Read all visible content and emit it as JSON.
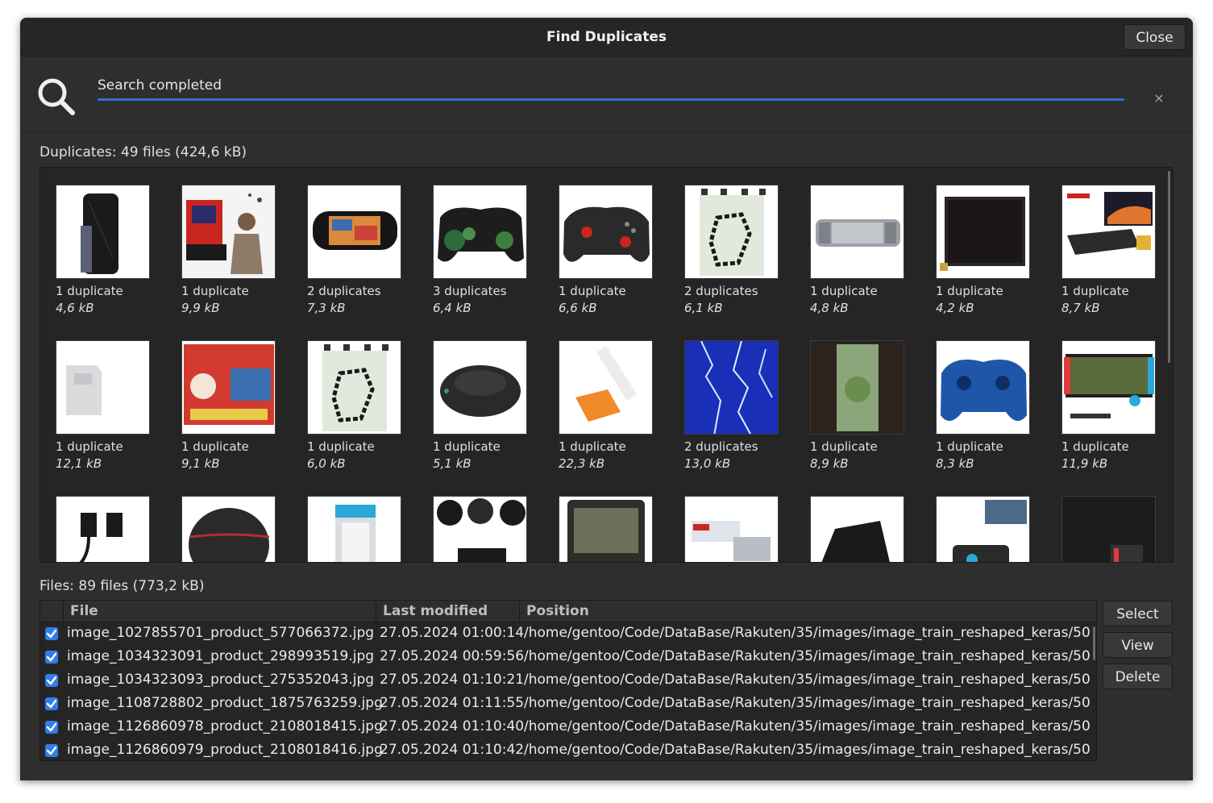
{
  "window": {
    "title": "Find Duplicates",
    "close_label": "Close"
  },
  "search": {
    "status": "Search completed",
    "progress": 1.0,
    "dismiss_glyph": "×"
  },
  "duplicates": {
    "summary": "Duplicates: 49 files (424,6 kB)",
    "items": [
      {
        "count": "1 duplicate",
        "size": "4,6 kB"
      },
      {
        "count": "1 duplicate",
        "size": "9,9 kB"
      },
      {
        "count": "2 duplicates",
        "size": "7,3 kB"
      },
      {
        "count": "3 duplicates",
        "size": "6,4 kB"
      },
      {
        "count": "1 duplicate",
        "size": "6,6 kB"
      },
      {
        "count": "2 duplicates",
        "size": "6,1 kB"
      },
      {
        "count": "1 duplicate",
        "size": "4,8 kB"
      },
      {
        "count": "1 duplicate",
        "size": "4,2 kB"
      },
      {
        "count": "1 duplicate",
        "size": "8,7 kB"
      },
      {
        "count": "1 duplicate",
        "size": "12,1 kB"
      },
      {
        "count": "1 duplicate",
        "size": "9,1 kB"
      },
      {
        "count": "1 duplicate",
        "size": "6,0 kB"
      },
      {
        "count": "1 duplicate",
        "size": "5,1 kB"
      },
      {
        "count": "1 duplicate",
        "size": "22,3 kB"
      },
      {
        "count": "2 duplicates",
        "size": "13,0 kB"
      },
      {
        "count": "1 duplicate",
        "size": "8,9 kB"
      },
      {
        "count": "1 duplicate",
        "size": "8,3 kB"
      },
      {
        "count": "1 duplicate",
        "size": "11,9 kB"
      }
    ]
  },
  "files": {
    "summary": "Files: 89 files (773,2 kB)",
    "columns": [
      "File",
      "Last modified",
      "Position"
    ],
    "rows": [
      {
        "file": "image_1027855701_product_577066372.jpg",
        "modified": "27.05.2024 01:00:14",
        "position": "/home/gentoo/Code/DataBase/Rakuten/35/images/image_train_reshaped_keras/50"
      },
      {
        "file": "image_1034323091_product_298993519.jpg",
        "modified": "27.05.2024 00:59:56",
        "position": "/home/gentoo/Code/DataBase/Rakuten/35/images/image_train_reshaped_keras/50"
      },
      {
        "file": "image_1034323093_product_275352043.jpg",
        "modified": "27.05.2024 01:10:21",
        "position": "/home/gentoo/Code/DataBase/Rakuten/35/images/image_train_reshaped_keras/50"
      },
      {
        "file": "image_1108728802_product_1875763259.jpg",
        "modified": "27.05.2024 01:11:55",
        "position": "/home/gentoo/Code/DataBase/Rakuten/35/images/image_train_reshaped_keras/50"
      },
      {
        "file": "image_1126860978_product_2108018415.jpg",
        "modified": "27.05.2024 01:10:40",
        "position": "/home/gentoo/Code/DataBase/Rakuten/35/images/image_train_reshaped_keras/50"
      },
      {
        "file": "image_1126860979_product_2108018416.jpg",
        "modified": "27.05.2024 01:10:42",
        "position": "/home/gentoo/Code/DataBase/Rakuten/35/images/image_train_reshaped_keras/50"
      }
    ]
  },
  "actions": {
    "select_label": "Select",
    "view_label": "View",
    "delete_label": "Delete"
  }
}
